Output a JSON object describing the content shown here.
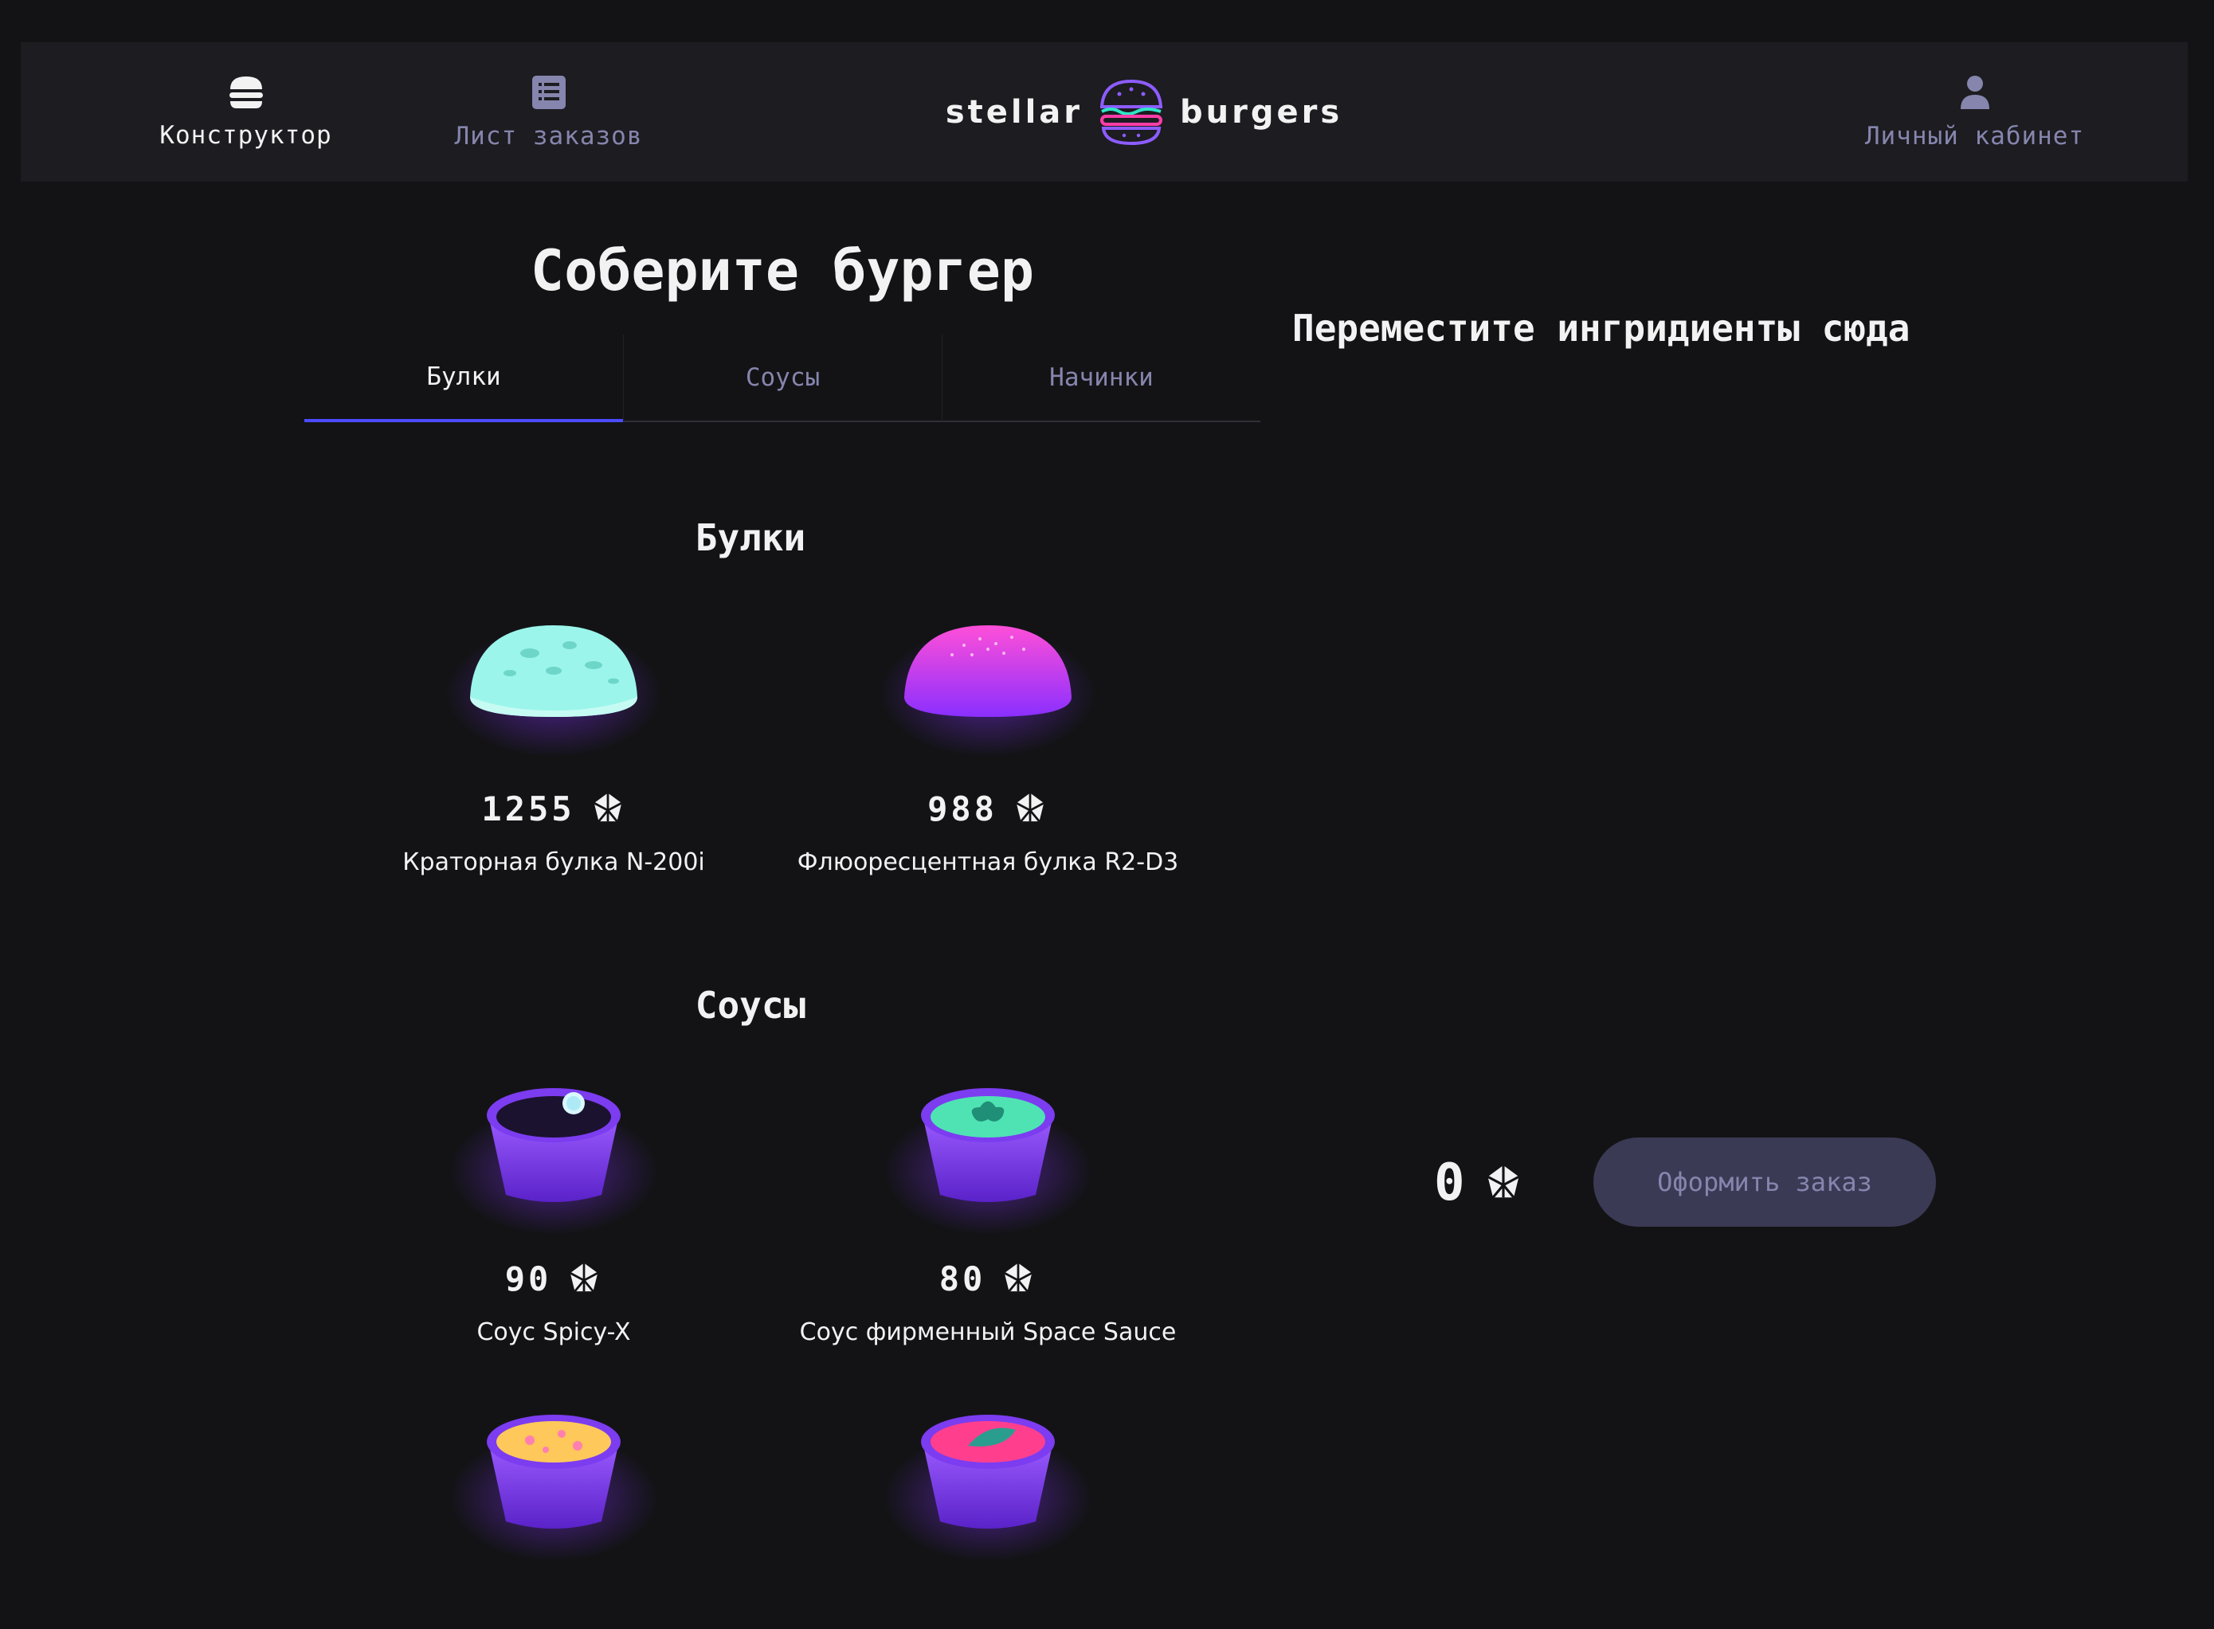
{
  "header": {
    "nav": {
      "constructor": "Конструктор",
      "orders": "Лист заказов",
      "profile": "Личный кабинет"
    },
    "logo": {
      "left": "stellar",
      "right": "burgers"
    }
  },
  "main": {
    "title": "Соберите бургер",
    "tabs": [
      {
        "label": "Булки",
        "active": true
      },
      {
        "label": "Соусы",
        "active": false
      },
      {
        "label": "Начинки",
        "active": false
      }
    ],
    "sections": [
      {
        "title": "Булки",
        "items": [
          {
            "name": "Краторная булка N-200i",
            "price": "1255",
            "icon": "bun-crater"
          },
          {
            "name": "Флюоресцентная булка R2-D3",
            "price": "988",
            "icon": "bun-fluorescent"
          }
        ]
      },
      {
        "title": "Соусы",
        "items": [
          {
            "name": "Соус Spicy-X",
            "price": "90",
            "icon": "sauce-spicy"
          },
          {
            "name": "Соус фирменный Space Sauce",
            "price": "80",
            "icon": "sauce-space"
          },
          {
            "icon": "sauce-traditional"
          },
          {
            "icon": "sauce-antarian"
          }
        ]
      }
    ]
  },
  "constructor": {
    "placeholder": "Переместите ингридиенты сюда",
    "total": "0",
    "order_button": "Оформить заказ"
  },
  "colors": {
    "background": "#131316",
    "header": "#1c1c21",
    "accent": "#4c4cff",
    "inactive_text": "#8585ad",
    "button_bg": "#3a3a55"
  }
}
